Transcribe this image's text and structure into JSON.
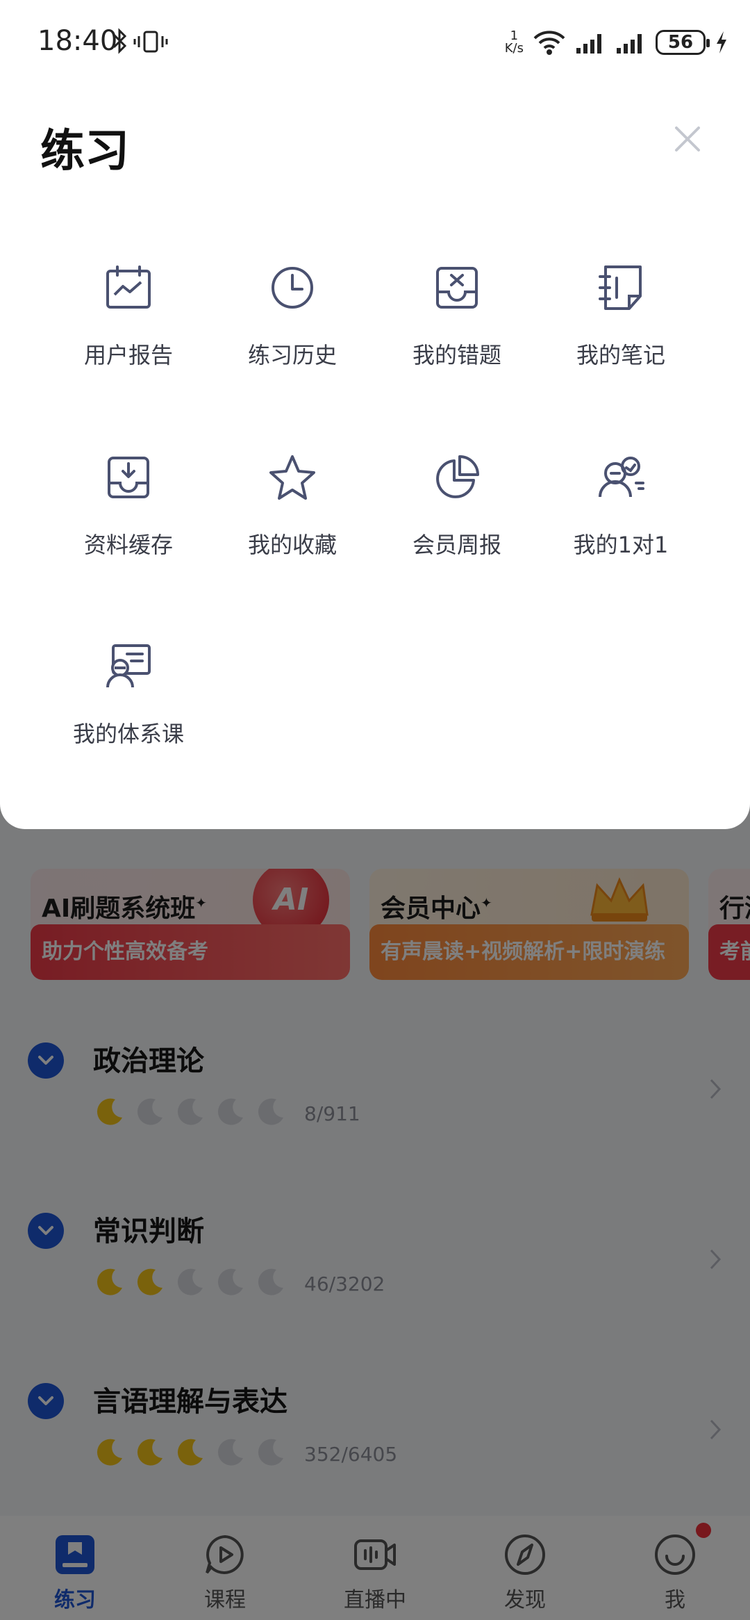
{
  "status_bar": {
    "time": "18:40",
    "net_speed_value": "1",
    "net_speed_unit": "K/s",
    "battery": "56"
  },
  "sheet": {
    "title": "练习",
    "items": [
      {
        "label": "用户报告",
        "icon": "report-chart-icon"
      },
      {
        "label": "练习历史",
        "icon": "clock-icon"
      },
      {
        "label": "我的错题",
        "icon": "wrong-tray-icon"
      },
      {
        "label": "我的笔记",
        "icon": "notebook-icon"
      },
      {
        "label": "资料缓存",
        "icon": "download-tray-icon"
      },
      {
        "label": "我的收藏",
        "icon": "star-icon"
      },
      {
        "label": "会员周报",
        "icon": "pie-chart-icon"
      },
      {
        "label": "我的1对1",
        "icon": "one-on-one-icon"
      },
      {
        "label": "我的体系课",
        "icon": "course-teacher-icon"
      }
    ]
  },
  "promos": [
    {
      "title": "AI刷题系统班",
      "subtitle": "助力个性高效备考",
      "badge": "AI"
    },
    {
      "title": "会员中心",
      "subtitle": "有声晨读+视频解析+限时演练"
    },
    {
      "title": "行测",
      "subtitle": "考前"
    }
  ],
  "subjects": [
    {
      "title": "政治理论",
      "progress": "8/911",
      "filled_moons": 1,
      "total_moons": 5
    },
    {
      "title": "常识判断",
      "progress": "46/3202",
      "filled_moons": 2,
      "total_moons": 5
    },
    {
      "title": "言语理解与表达",
      "progress": "352/6405",
      "filled_moons": 3,
      "total_moons": 5
    }
  ],
  "tabbar": [
    {
      "label": "练习",
      "active": true
    },
    {
      "label": "课程",
      "active": false
    },
    {
      "label": "直播中",
      "active": false
    },
    {
      "label": "发现",
      "active": false
    },
    {
      "label": "我",
      "active": false
    }
  ],
  "colors": {
    "accent": "#1f57d6",
    "icon_stroke": "#4a5170",
    "moon_filled": "#f5c518",
    "moon_empty": "#d6d8de",
    "promo_red": "#f03a48",
    "promo_orange": "#ff8a3c"
  }
}
